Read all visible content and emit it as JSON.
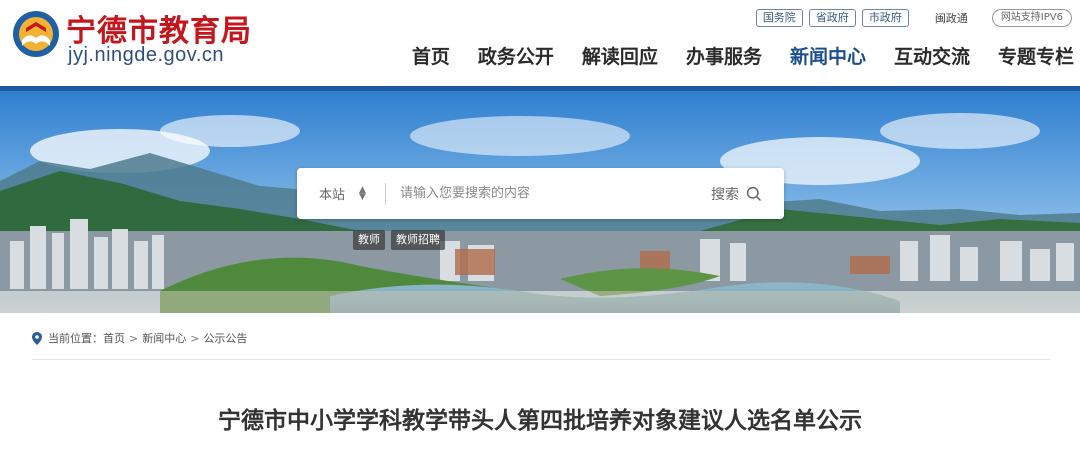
{
  "site": {
    "name": "宁德市教育局",
    "domain": "jyj.ningde.gov.cn"
  },
  "top_links": {
    "guowuyuan": "国务院",
    "shengzhengfu": "省政府",
    "shizhengfu": "市政府",
    "minzhengtong": "闽政通",
    "ipv6": "网站支持IPV6"
  },
  "nav": {
    "items": [
      {
        "label": "首页"
      },
      {
        "label": "政务公开"
      },
      {
        "label": "解读回应"
      },
      {
        "label": "办事服务"
      },
      {
        "label": "新闻中心"
      },
      {
        "label": "互动交流"
      },
      {
        "label": "专题专栏"
      }
    ],
    "active_index": 4
  },
  "search": {
    "scope": "本站",
    "placeholder": "请输入您要搜索的内容",
    "button_label": "搜索"
  },
  "hot_tags": [
    "教师",
    "教师招聘"
  ],
  "breadcrumb": {
    "prefix": "当前位置：",
    "items": [
      "首页",
      "新闻中心",
      "公示公告"
    ],
    "separator": ">"
  },
  "article": {
    "title": "宁德市中小学学科教学带头人第四批培养对象建议人选名单公示"
  },
  "colors": {
    "brand_red": "#c4161c",
    "brand_blue": "#1d58a0",
    "nav_active": "#1d4e8c"
  }
}
